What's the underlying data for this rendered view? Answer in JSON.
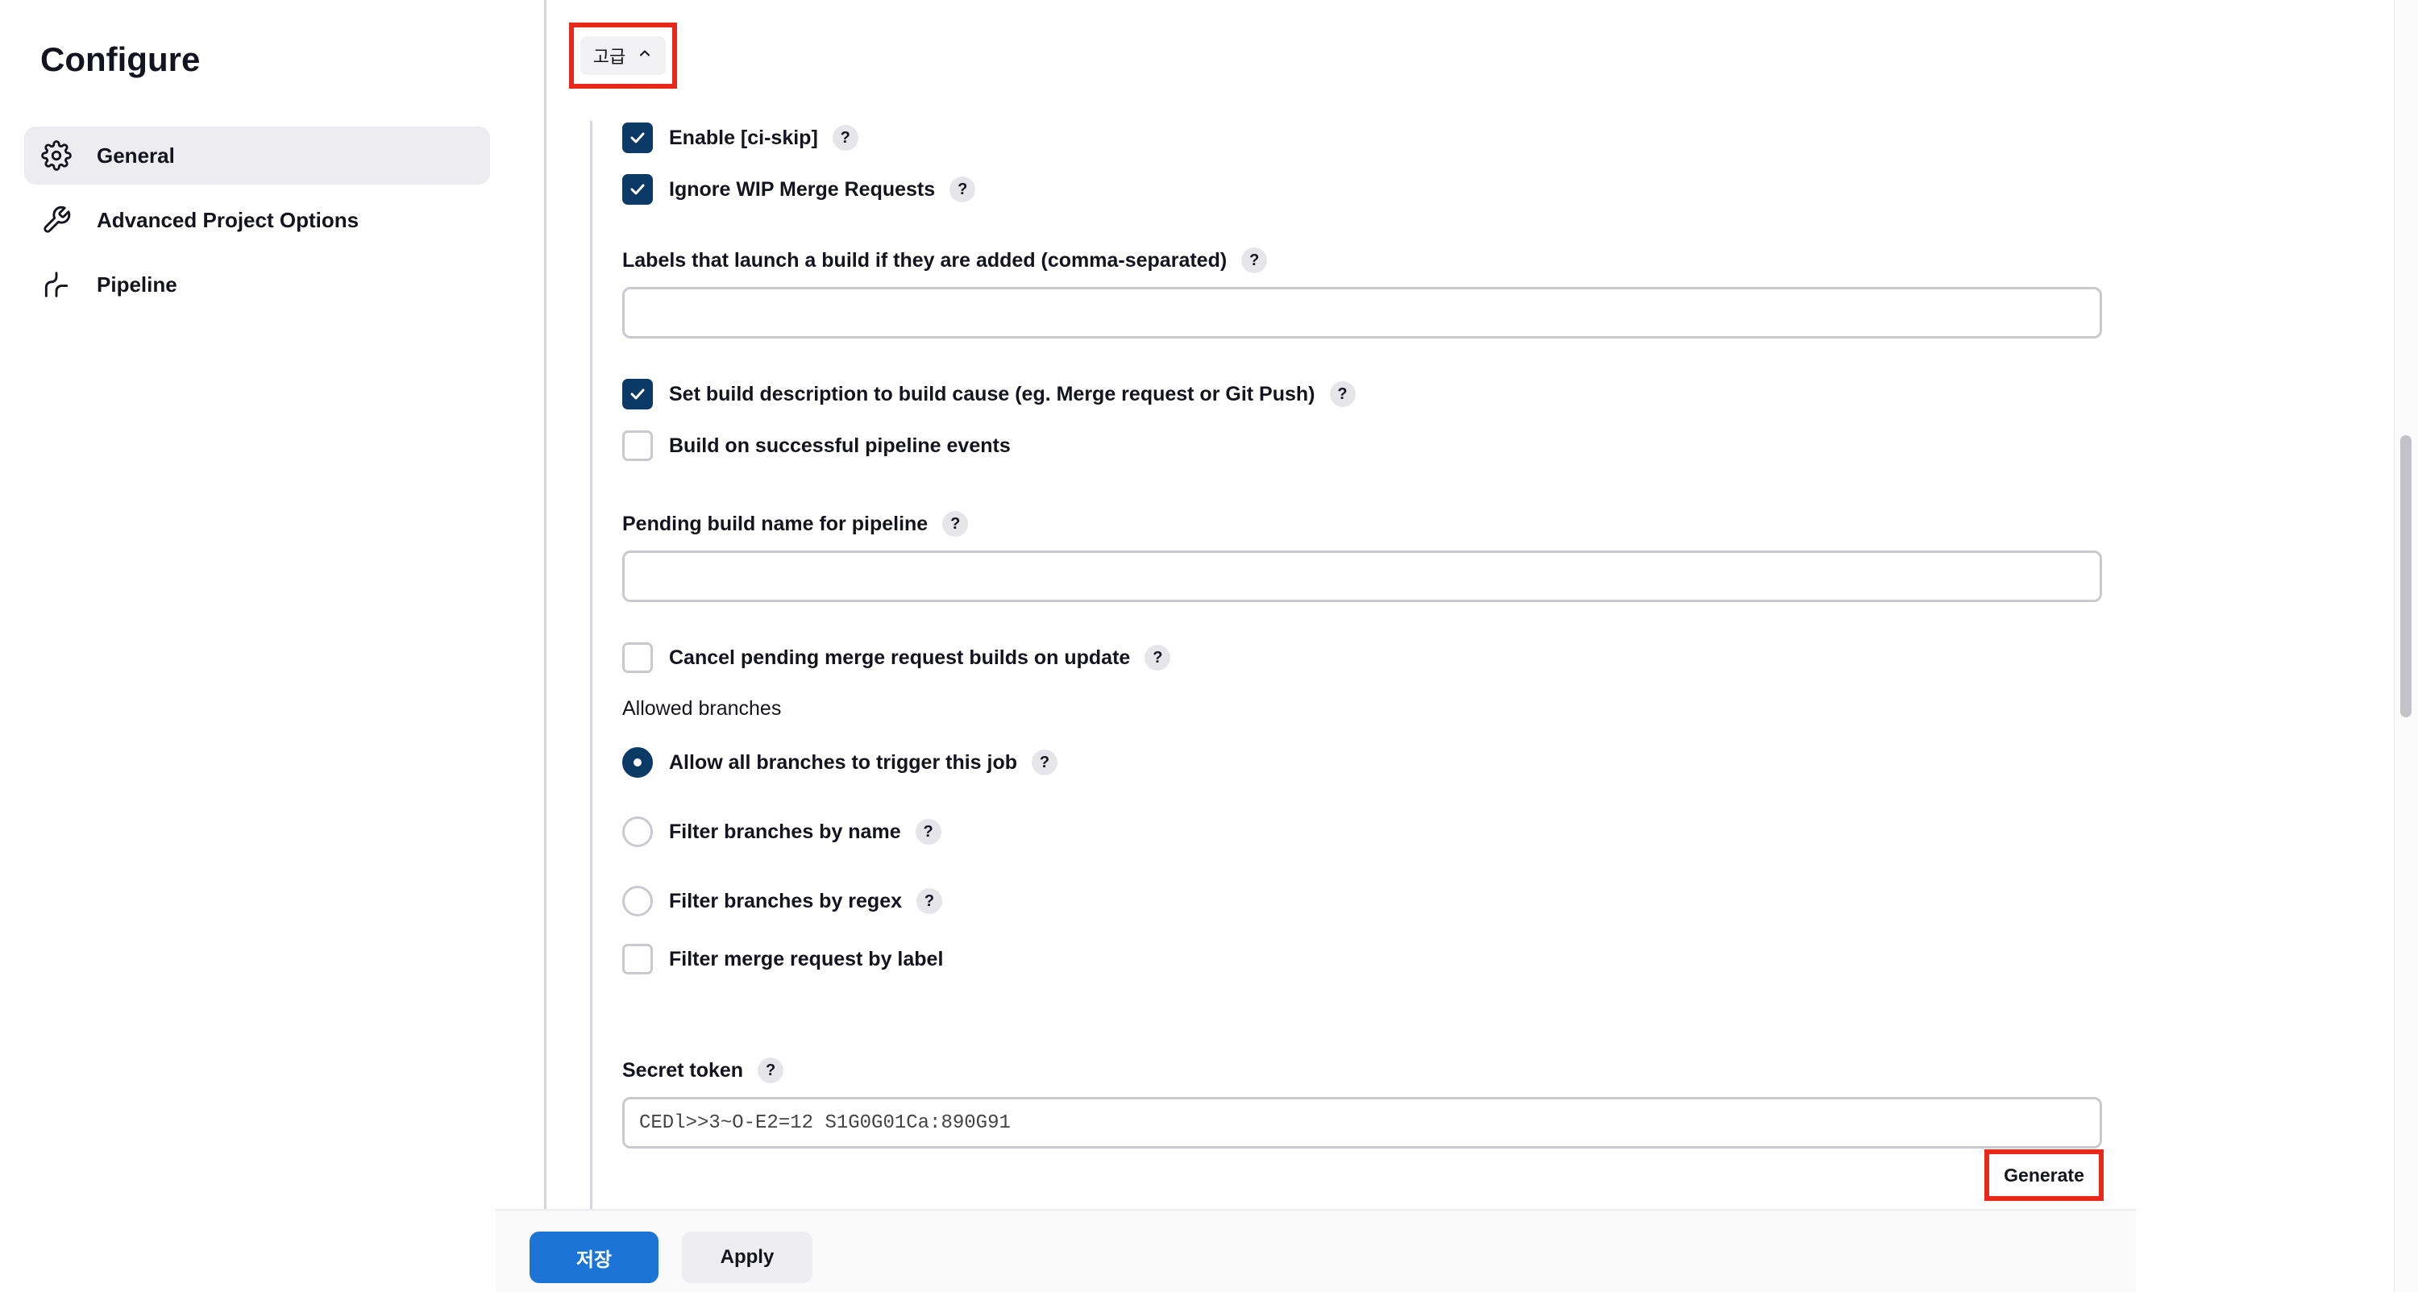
{
  "sidebar": {
    "title": "Configure",
    "items": [
      {
        "label": "General",
        "icon": "gear-icon",
        "active": true
      },
      {
        "label": "Advanced Project Options",
        "icon": "wrench-icon",
        "active": false
      },
      {
        "label": "Pipeline",
        "icon": "pipeline-icon",
        "active": false
      }
    ]
  },
  "advanced": {
    "label": "고급",
    "icon": "chevron-up-icon"
  },
  "options": {
    "ci_skip": {
      "label": "Enable [ci-skip]",
      "checked": true
    },
    "ignore_wip": {
      "label": "Ignore WIP Merge Requests",
      "checked": true
    },
    "labels_field": {
      "label": "Labels that launch a build if they are added (comma-separated)",
      "value": ""
    },
    "set_description": {
      "label": "Set build description to build cause (eg. Merge request or Git Push)",
      "checked": true
    },
    "pipeline_events": {
      "label": "Build on successful pipeline events",
      "checked": false
    },
    "pending_name": {
      "label": "Pending build name for pipeline",
      "value": ""
    },
    "cancel_pending": {
      "label": "Cancel pending merge request builds on update",
      "checked": false
    },
    "allowed_branches": {
      "label": "Allowed branches",
      "options": [
        {
          "label": "Allow all branches to trigger this job",
          "selected": true
        },
        {
          "label": "Filter branches by name",
          "selected": false
        },
        {
          "label": "Filter branches by regex",
          "selected": false
        }
      ]
    },
    "filter_label": {
      "label": "Filter merge request by label",
      "checked": false
    },
    "secret_token": {
      "label": "Secret token",
      "value": "CEDl>>3~O-E2=12 S1G0G01Ca:890G91"
    },
    "help_text": "?"
  },
  "buttons": {
    "generate": "Generate",
    "save": "저장",
    "apply": "Apply"
  },
  "colors": {
    "accent": "#1b74d6",
    "checkbox": "#0b3a66",
    "highlight": "#e8281b"
  }
}
